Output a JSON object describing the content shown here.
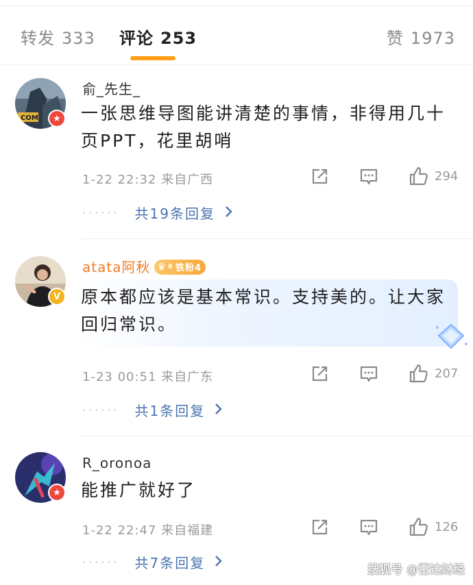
{
  "tabs": {
    "repost": {
      "label": "转发",
      "count": "333"
    },
    "comment": {
      "label": "评论",
      "count": "253"
    },
    "like": {
      "label": "赞",
      "count": "1973"
    }
  },
  "accent_color": "#ff9d14",
  "comments": [
    {
      "username": "俞_先生_",
      "text": "一张思维导图能讲清楚的事情，非得用几十页PPT，花里胡哨",
      "time_location": "1-22 22:32 来自广西",
      "likes": "294",
      "replies": "共19条回复",
      "avatar_badge": "red"
    },
    {
      "username": "atata阿秋",
      "fan_badge": "铁粉4",
      "fan_level": "6",
      "text": "原本都应该是基本常识。支持美的。让大家回归常识。",
      "time_location": "1-23 00:51 来自广东",
      "likes": "207",
      "replies": "共1条回复",
      "avatar_badge": "gold",
      "avatar_badge_text": "V"
    },
    {
      "username": "R_oronoa",
      "text": "能推广就好了",
      "time_location": "1-22 22:47 来自福建",
      "likes": "126",
      "replies": "共7条回复",
      "avatar_badge": "red"
    }
  ],
  "icons": {
    "share": "share-icon",
    "comment": "comment-icon",
    "like": "thumbs-up-icon",
    "more": "chevron-right-icon"
  },
  "watermark": "搜狐号 @雷达财经",
  "dots": "······"
}
